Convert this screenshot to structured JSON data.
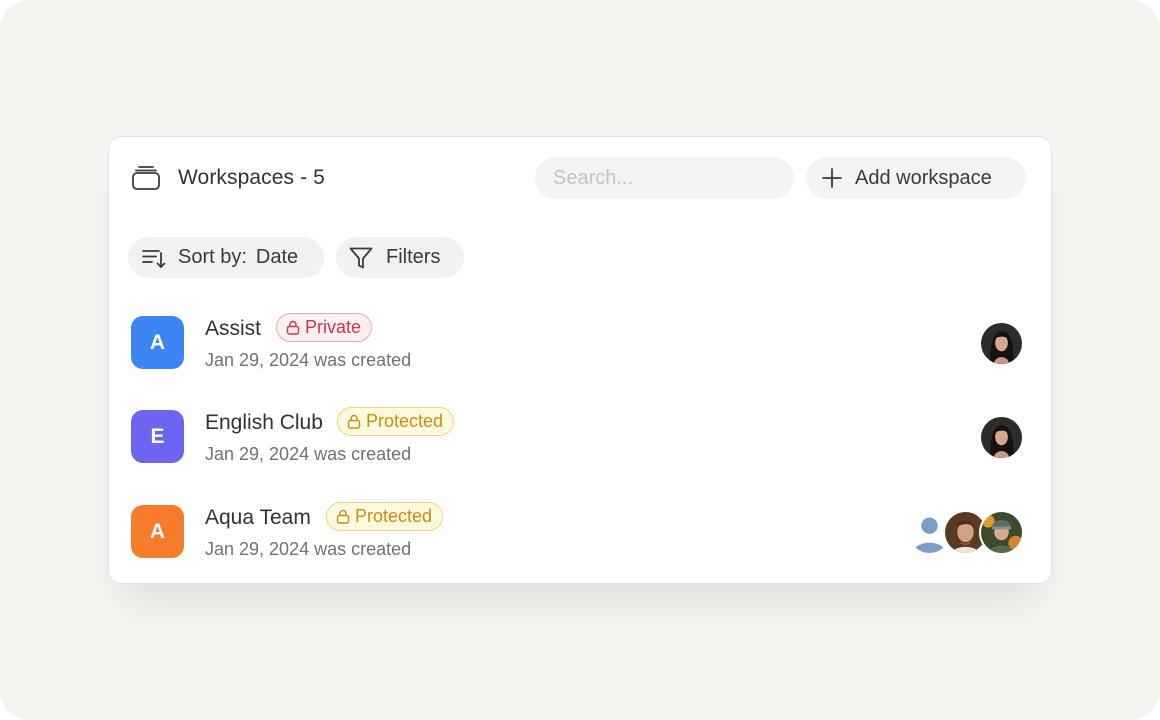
{
  "header": {
    "title": "Workspaces - 5",
    "icon": "stack-icon",
    "search_placeholder": "Search...",
    "add_button_label": "Add workspace"
  },
  "toolbar": {
    "sort_label": "Sort by:",
    "sort_value": "Date",
    "filters_label": "Filters"
  },
  "workspaces": [
    {
      "letter": "A",
      "color": "#3d84f4",
      "name": "Assist",
      "badge": "Private",
      "created": "Jan 29, 2024 was created",
      "members": [
        "woman-portrait"
      ]
    },
    {
      "letter": "E",
      "color": "#6b65f2",
      "name": "English Club",
      "badge": "Protected",
      "created": "Jan 29, 2024 was created",
      "members": [
        "woman-portrait"
      ]
    },
    {
      "letter": "A",
      "color": "#f47c2a",
      "name": "Aqua Team",
      "badge": "Protected",
      "created": "Jan 29, 2024 was created",
      "members": [
        "placeholder-user",
        "man-portrait",
        "man-in-hat-portrait"
      ]
    }
  ],
  "colors": {
    "background": "#f4f3ef",
    "card": "#ffffff",
    "private_text": "#d6314f",
    "protected_text": "#cd8d0c"
  }
}
